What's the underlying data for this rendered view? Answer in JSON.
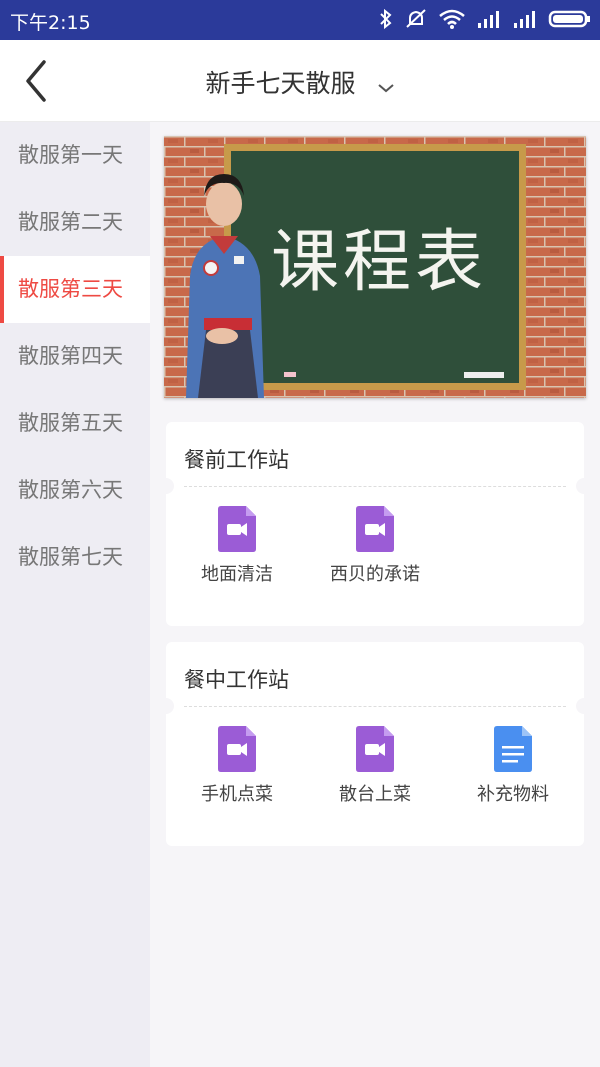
{
  "status_bar": {
    "time": "下午2:15"
  },
  "header": {
    "title": "新手七天散服"
  },
  "sidebar": {
    "items": [
      {
        "label": "散服第一天"
      },
      {
        "label": "散服第二天"
      },
      {
        "label": "散服第三天"
      },
      {
        "label": "散服第四天"
      },
      {
        "label": "散服第五天"
      },
      {
        "label": "散服第六天"
      },
      {
        "label": "散服第七天"
      }
    ],
    "active_index": 2
  },
  "banner": {
    "chalkboard_text": "课程表"
  },
  "sections": [
    {
      "title": "餐前工作站",
      "items": [
        {
          "label": "地面清洁",
          "icon": "video-file-icon"
        },
        {
          "label": "西贝的承诺",
          "icon": "video-file-icon"
        }
      ]
    },
    {
      "title": "餐中工作站",
      "items": [
        {
          "label": "手机点菜",
          "icon": "video-file-icon"
        },
        {
          "label": "散台上菜",
          "icon": "video-file-icon"
        },
        {
          "label": "补充物料",
          "icon": "document-file-icon"
        }
      ]
    }
  ],
  "colors": {
    "status_bar": "#2b3a9a",
    "accent": "#ee4a43",
    "video_icon": "#9b5cd6",
    "doc_icon": "#4a8ff0"
  }
}
